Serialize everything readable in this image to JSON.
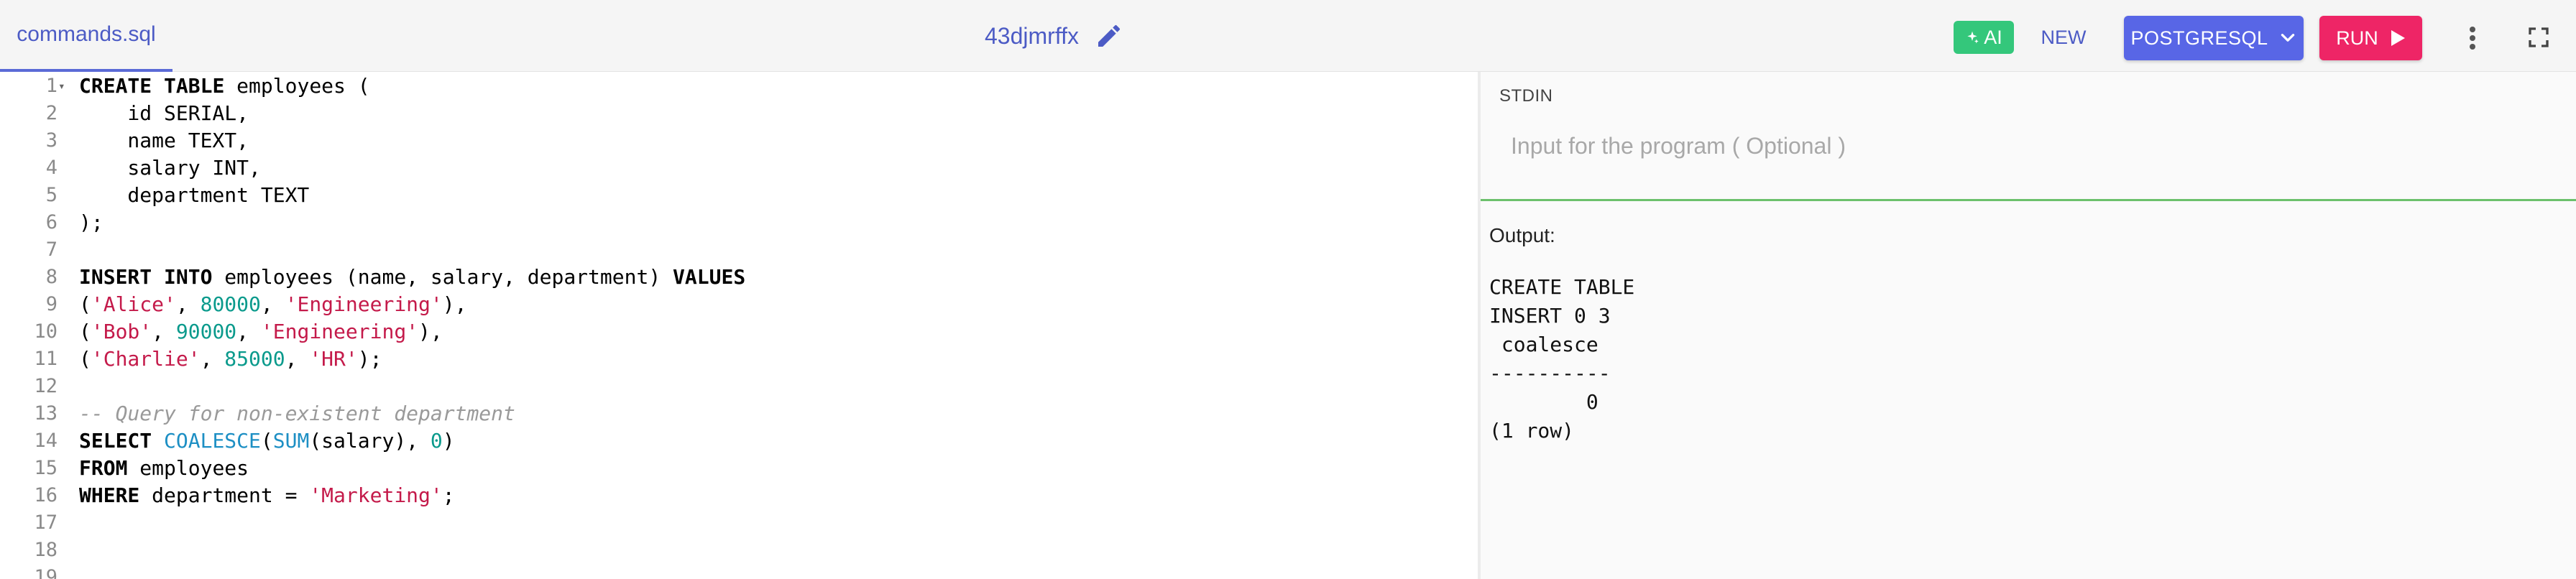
{
  "toolbar": {
    "file_tab": "commands.sql",
    "project_name": "43djmrffx",
    "ai_label": "AI",
    "new_label": "NEW",
    "language_label": "POSTGRESQL",
    "run_label": "RUN"
  },
  "colors": {
    "accent": "#5866e6",
    "run": "#ee2566",
    "ai": "#34c77b",
    "stdin_border": "#6cc06c"
  },
  "icons": {
    "edit": "pencil-icon",
    "ai": "sparkle-icon",
    "language_dropdown": "chevron-down-icon",
    "run": "play-icon",
    "more": "more-vertical-icon",
    "fullscreen": "fullscreen-icon",
    "fold": "fold-arrow-icon"
  },
  "editor": {
    "lines": [
      {
        "n": "1",
        "t": [
          {
            "c": "kw",
            "v": "CREATE"
          },
          {
            "c": "",
            "v": " "
          },
          {
            "c": "kw",
            "v": "TABLE"
          },
          {
            "c": "",
            "v": " employees ("
          }
        ]
      },
      {
        "n": "2",
        "t": [
          {
            "c": "",
            "v": "    id SERIAL,"
          }
        ]
      },
      {
        "n": "3",
        "t": [
          {
            "c": "",
            "v": "    name TEXT,"
          }
        ]
      },
      {
        "n": "4",
        "t": [
          {
            "c": "",
            "v": "    salary INT,"
          }
        ]
      },
      {
        "n": "5",
        "t": [
          {
            "c": "",
            "v": "    department TEXT"
          }
        ]
      },
      {
        "n": "6",
        "t": [
          {
            "c": "",
            "v": ");"
          }
        ]
      },
      {
        "n": "7",
        "t": []
      },
      {
        "n": "8",
        "t": [
          {
            "c": "kw",
            "v": "INSERT"
          },
          {
            "c": "",
            "v": " "
          },
          {
            "c": "kw",
            "v": "INTO"
          },
          {
            "c": "",
            "v": " employees (name, salary, department) "
          },
          {
            "c": "kw",
            "v": "VALUES"
          }
        ]
      },
      {
        "n": "9",
        "t": [
          {
            "c": "",
            "v": "("
          },
          {
            "c": "str",
            "v": "'Alice'"
          },
          {
            "c": "",
            "v": ", "
          },
          {
            "c": "num",
            "v": "80000"
          },
          {
            "c": "",
            "v": ", "
          },
          {
            "c": "str",
            "v": "'Engineering'"
          },
          {
            "c": "",
            "v": "),"
          }
        ]
      },
      {
        "n": "10",
        "t": [
          {
            "c": "",
            "v": "("
          },
          {
            "c": "str",
            "v": "'Bob'"
          },
          {
            "c": "",
            "v": ", "
          },
          {
            "c": "num",
            "v": "90000"
          },
          {
            "c": "",
            "v": ", "
          },
          {
            "c": "str",
            "v": "'Engineering'"
          },
          {
            "c": "",
            "v": "),"
          }
        ]
      },
      {
        "n": "11",
        "t": [
          {
            "c": "",
            "v": "("
          },
          {
            "c": "str",
            "v": "'Charlie'"
          },
          {
            "c": "",
            "v": ", "
          },
          {
            "c": "num",
            "v": "85000"
          },
          {
            "c": "",
            "v": ", "
          },
          {
            "c": "str",
            "v": "'HR'"
          },
          {
            "c": "",
            "v": ");"
          }
        ]
      },
      {
        "n": "12",
        "t": []
      },
      {
        "n": "13",
        "t": [
          {
            "c": "cmt",
            "v": "-- Query for non-existent department"
          }
        ]
      },
      {
        "n": "14",
        "t": [
          {
            "c": "kw",
            "v": "SELECT"
          },
          {
            "c": "",
            "v": " "
          },
          {
            "c": "fn",
            "v": "COALESCE"
          },
          {
            "c": "",
            "v": "("
          },
          {
            "c": "fn",
            "v": "SUM"
          },
          {
            "c": "",
            "v": "(salary), "
          },
          {
            "c": "num",
            "v": "0"
          },
          {
            "c": "",
            "v": ")"
          }
        ]
      },
      {
        "n": "15",
        "t": [
          {
            "c": "kw",
            "v": "FROM"
          },
          {
            "c": "",
            "v": " employees"
          }
        ]
      },
      {
        "n": "16",
        "t": [
          {
            "c": "kw",
            "v": "WHERE"
          },
          {
            "c": "",
            "v": " department = "
          },
          {
            "c": "str",
            "v": "'Marketing'"
          },
          {
            "c": "",
            "v": ";"
          }
        ]
      },
      {
        "n": "17",
        "t": []
      },
      {
        "n": "18",
        "t": []
      },
      {
        "n": "19",
        "t": []
      }
    ]
  },
  "stdin": {
    "label": "STDIN",
    "placeholder": "Input for the program ( Optional )"
  },
  "output": {
    "label": "Output:",
    "lines": [
      "CREATE TABLE",
      "INSERT 0 3",
      " coalesce",
      "----------",
      "        0",
      "(1 row)"
    ]
  }
}
